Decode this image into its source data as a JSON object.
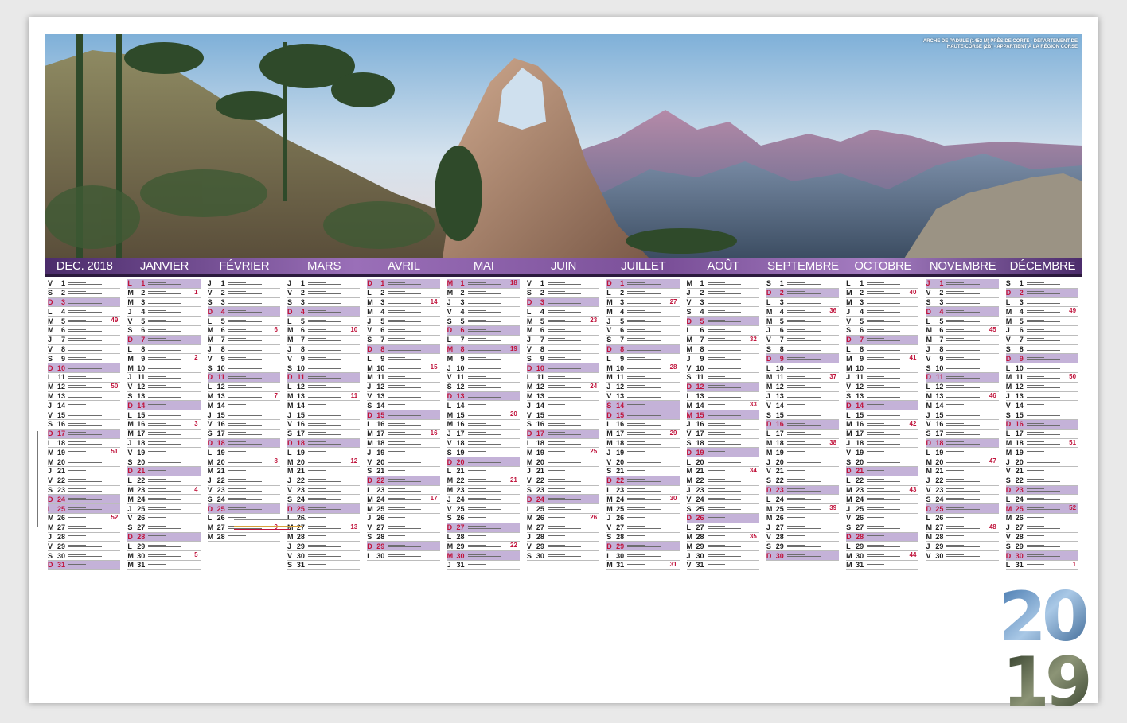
{
  "caption": "ARCHE DE PADULE (1452 M) PRÈS DE CORTE - DÉPARTEMENT DE HAUTE-CORSE (2B) - APPARTIENT À LA RÉGION CORSE",
  "year": "2019",
  "year_top": "20",
  "year_bottom": "19",
  "colors": {
    "accent": "#7a4f98",
    "sunday": "#c4b2d8",
    "red": "#c0143c"
  },
  "months": [
    {
      "name": "DEC. 2018",
      "first_weekday": 5,
      "days": 31,
      "holidays": [
        25
      ],
      "week_numbers": [
        {
          "day": 5,
          "num": "49"
        },
        {
          "day": 12,
          "num": "50"
        },
        {
          "day": 19,
          "num": "51"
        },
        {
          "day": 26,
          "num": "52"
        }
      ]
    },
    {
      "name": "JANVIER",
      "first_weekday": 1,
      "days": 31,
      "holidays": [
        1
      ],
      "week_numbers": [
        {
          "day": 2,
          "num": "1"
        },
        {
          "day": 9,
          "num": "2"
        },
        {
          "day": 16,
          "num": "3"
        },
        {
          "day": 23,
          "num": "4"
        },
        {
          "day": 30,
          "num": "5"
        }
      ]
    },
    {
      "name": "FÉVRIER",
      "first_weekday": 4,
      "days": 28,
      "holidays": [],
      "week_numbers": [
        {
          "day": 6,
          "num": "6"
        },
        {
          "day": 13,
          "num": "7"
        },
        {
          "day": 20,
          "num": "8"
        },
        {
          "day": 27,
          "num": "9"
        }
      ]
    },
    {
      "name": "MARS",
      "first_weekday": 4,
      "days": 31,
      "holidays": [],
      "week_numbers": [
        {
          "day": 6,
          "num": "10"
        },
        {
          "day": 13,
          "num": "11"
        },
        {
          "day": 20,
          "num": "12"
        },
        {
          "day": 27,
          "num": "13"
        }
      ]
    },
    {
      "name": "AVRIL",
      "first_weekday": 0,
      "days": 30,
      "holidays": [
        22
      ],
      "week_numbers": [
        {
          "day": 3,
          "num": "14"
        },
        {
          "day": 10,
          "num": "15"
        },
        {
          "day": 17,
          "num": "16"
        },
        {
          "day": 24,
          "num": "17"
        }
      ]
    },
    {
      "name": "MAI",
      "first_weekday": 2,
      "days": 31,
      "holidays": [
        1,
        8,
        30
      ],
      "week_numbers": [
        {
          "day": 1,
          "num": "18"
        },
        {
          "day": 8,
          "num": "19"
        },
        {
          "day": 15,
          "num": "20"
        },
        {
          "day": 22,
          "num": "21"
        },
        {
          "day": 29,
          "num": "22"
        }
      ]
    },
    {
      "name": "JUIN",
      "first_weekday": 5,
      "days": 30,
      "holidays": [
        10
      ],
      "week_numbers": [
        {
          "day": 5,
          "num": "23"
        },
        {
          "day": 12,
          "num": "24"
        },
        {
          "day": 19,
          "num": "25"
        },
        {
          "day": 26,
          "num": "26"
        }
      ]
    },
    {
      "name": "JUILLET",
      "first_weekday": 0,
      "days": 31,
      "holidays": [
        14
      ],
      "week_numbers": [
        {
          "day": 3,
          "num": "27"
        },
        {
          "day": 10,
          "num": "28"
        },
        {
          "day": 17,
          "num": "29"
        },
        {
          "day": 24,
          "num": "30"
        },
        {
          "day": 31,
          "num": "31"
        }
      ]
    },
    {
      "name": "AOÛT",
      "first_weekday": 3,
      "days": 31,
      "holidays": [
        15
      ],
      "week_numbers": [
        {
          "day": 7,
          "num": "32"
        },
        {
          "day": 14,
          "num": "33"
        },
        {
          "day": 21,
          "num": "34"
        },
        {
          "day": 28,
          "num": "35"
        }
      ]
    },
    {
      "name": "SEPTEMBRE",
      "first_weekday": 6,
      "days": 30,
      "holidays": [],
      "week_numbers": [
        {
          "day": 4,
          "num": "36"
        },
        {
          "day": 11,
          "num": "37"
        },
        {
          "day": 18,
          "num": "38"
        },
        {
          "day": 25,
          "num": "39"
        }
      ]
    },
    {
      "name": "OCTOBRE",
      "first_weekday": 1,
      "days": 31,
      "holidays": [],
      "week_numbers": [
        {
          "day": 2,
          "num": "40"
        },
        {
          "day": 9,
          "num": "41"
        },
        {
          "day": 16,
          "num": "42"
        },
        {
          "day": 23,
          "num": "43"
        },
        {
          "day": 30,
          "num": "44"
        }
      ]
    },
    {
      "name": "NOVEMBRE",
      "first_weekday": 4,
      "days": 30,
      "holidays": [
        1,
        11
      ],
      "week_numbers": [
        {
          "day": 6,
          "num": "45"
        },
        {
          "day": 13,
          "num": "46"
        },
        {
          "day": 20,
          "num": "47"
        },
        {
          "day": 27,
          "num": "48"
        }
      ]
    },
    {
      "name": "DÉCEMBRE",
      "first_weekday": 6,
      "days": 31,
      "holidays": [
        25
      ],
      "week_numbers": [
        {
          "day": 4,
          "num": "49"
        },
        {
          "day": 11,
          "num": "50"
        },
        {
          "day": 18,
          "num": "51"
        },
        {
          "day": 25,
          "num": "52"
        },
        {
          "day": 31,
          "num": "1"
        }
      ]
    }
  ],
  "weekday_letters": [
    "D",
    "L",
    "M",
    "M",
    "J",
    "V",
    "S"
  ]
}
